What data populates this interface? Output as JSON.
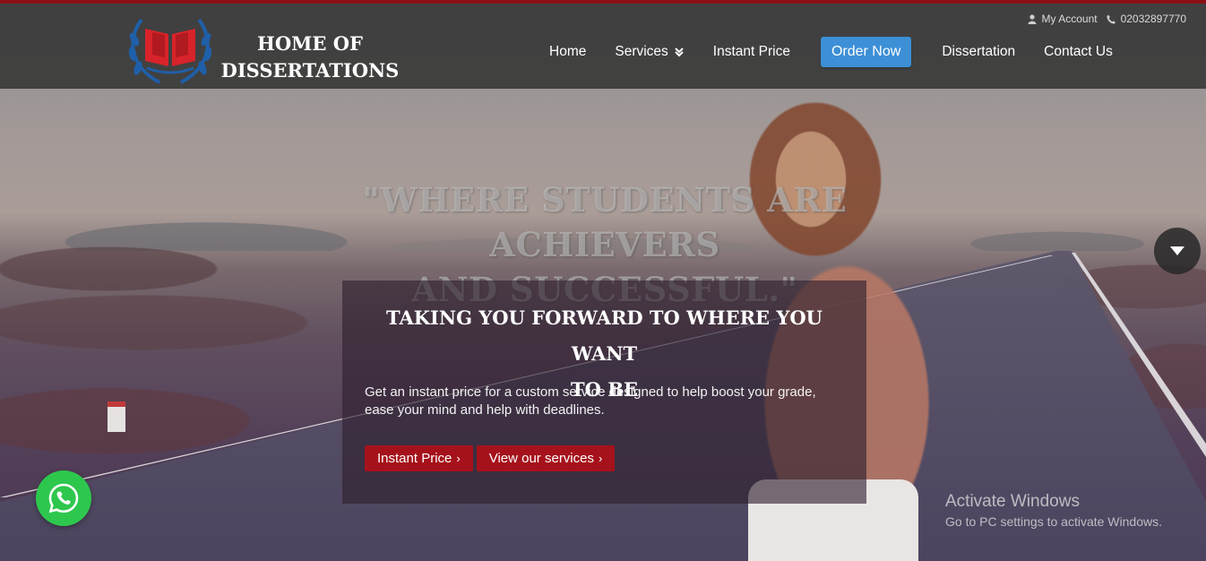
{
  "brand": {
    "line1": "HOME OF",
    "line2": "DISSERTATIONS",
    "accent_red": "#a5121b",
    "accent_blue": "#3d8fd6"
  },
  "account_bar": {
    "account_label": "My Account",
    "account_icon": "user-icon",
    "phone": "02032897770",
    "phone_icon": "phone-icon"
  },
  "nav": {
    "items": [
      {
        "label": "Home"
      },
      {
        "label": "Services",
        "icon": "chevron-double-down-icon"
      },
      {
        "label": "Instant Price"
      },
      {
        "label": "Order Now"
      },
      {
        "label": "Dissertation"
      },
      {
        "label": "Contact Us"
      }
    ]
  },
  "hero": {
    "quote_line1": "\"WHERE STUDENTS ARE ACHIEVERS",
    "quote_line2": "AND SUCCESSFUL.\"",
    "panel": {
      "title_line1": "TAKING YOU FORWARD TO WHERE YOU WANT",
      "title_line2": "TO BE",
      "description": "Get an instant price for a custom service designed to help boost your grade, ease your mind and help with deadlines.",
      "buttons": [
        {
          "label": "Instant Price",
          "icon": "chevron-right-icon"
        },
        {
          "label": "View our services",
          "icon": "chevron-right-icon"
        }
      ]
    }
  },
  "floating": {
    "scroll_icon": "caret-down-icon",
    "whatsapp_icon": "whatsapp-icon"
  },
  "watermark": {
    "title": "Activate Windows",
    "subtitle": "Go to PC settings to activate Windows."
  }
}
